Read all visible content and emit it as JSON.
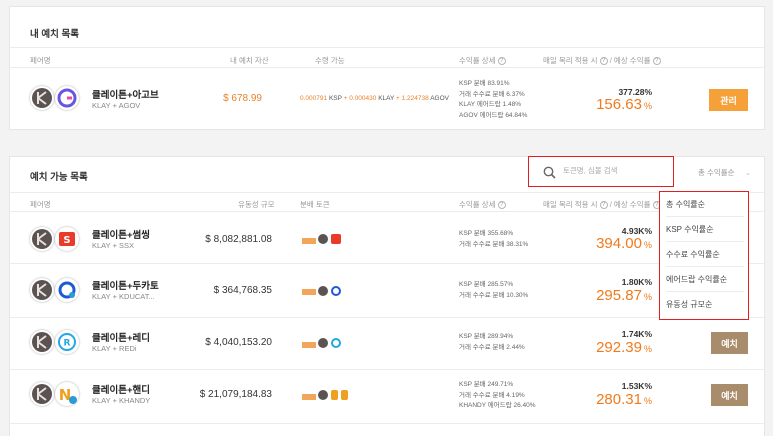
{
  "my_deposits": {
    "title": "내 예치 목록",
    "headers": {
      "pair": "페어명",
      "my_assets": "내 예치 자산",
      "claimable": "수령 가능",
      "yield_detail": "수익률 상세",
      "expected_yield": "매일 복리 적용 시",
      "expected_yield2": "/ 예상 수익률"
    },
    "row": {
      "name": "클레이튼+아고브",
      "symbols": "KLAY + AGOV",
      "amount": "$ 678.99",
      "claim_ksp": "0.000791",
      "claim_ksp_label": "KSP",
      "claim_klay": "0.000430",
      "claim_klay_label": "KLAY",
      "claim_agov": "1.224738",
      "claim_agov_label": "AGOV",
      "details": [
        "KSP 분배 83.91%",
        "거래 수수료 분배 6.37%",
        "KLAY 에어드랍 1.48%",
        "AGOV 에어드랍 64.84%"
      ],
      "pct_small": "377.28",
      "pct_big": "156.63",
      "button": "관리"
    }
  },
  "available": {
    "title": "예치 가능 목록",
    "search_placeholder": "토큰명, 심볼 검색",
    "sort_label": "총 수익률순",
    "headers": {
      "pair": "페어명",
      "liquidity": "유동성 규모",
      "dist_token": "분배 토큰",
      "yield_detail": "수익률 상세",
      "expected_yield": "매일 복리 적용 시",
      "expected_yield2": "/ 예상 수익률"
    },
    "rows": [
      {
        "name": "클레이튼+썸씽",
        "symbols": "KLAY + SSX",
        "liquidity": "$ 8,082,881.08",
        "details": [
          "KSP 분배 355.68%",
          "거래 수수료 분배 38.31%"
        ],
        "pct_small": "4.93K",
        "pct_big": "394.00",
        "button": ""
      },
      {
        "name": "클레이튼+두카토",
        "symbols": "KLAY + KDUCAT...",
        "liquidity": "$ 364,768.35",
        "details": [
          "KSP 분배 285.57%",
          "거래 수수료 분배 10.30%"
        ],
        "pct_small": "1.80K",
        "pct_big": "295.87",
        "button": ""
      },
      {
        "name": "클레이튼+레디",
        "symbols": "KLAY + REDi",
        "liquidity": "$ 4,040,153.20",
        "details": [
          "KSP 분배 289.94%",
          "거래 수수료 분배 2.44%"
        ],
        "pct_small": "1.74K",
        "pct_big": "292.39",
        "button": "예치"
      },
      {
        "name": "클레이튼+핸디",
        "symbols": "KLAY + KHANDY",
        "liquidity": "$ 21,079,184.83",
        "details": [
          "KSP 분배 249.71%",
          "거래 수수료 분배 4.19%",
          "KHANDY 에어드랍 26.40%"
        ],
        "pct_small": "1.53K",
        "pct_big": "280.31",
        "button": "예치"
      }
    ],
    "sort_options": [
      "총 수익률순",
      "KSP 수익률순",
      "수수료 수익률순",
      "에어드랍 수익률순",
      "유동성 규모순"
    ]
  },
  "units": {
    "percent": "%"
  },
  "colors": {
    "accent_orange": "#f07a1c",
    "button_manage": "#f6a03a",
    "button_deposit": "#a98c6b",
    "highlight_red": "#e02020"
  }
}
